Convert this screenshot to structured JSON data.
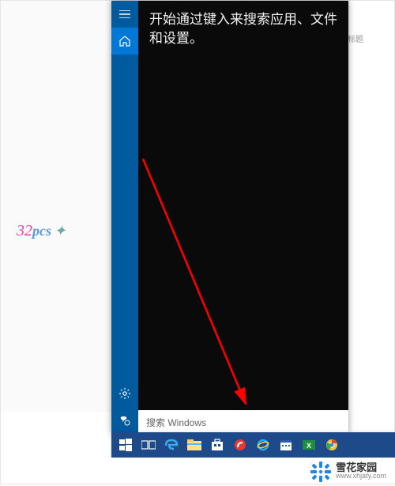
{
  "desktop": {
    "logo_text_1": "32",
    "logo_text_2": "pcs"
  },
  "right_app": {
    "title": "标题"
  },
  "start": {
    "hint": "开始通过键入来搜索应用、文件和设置。",
    "search_placeholder": "搜索 Windows",
    "sidebar": {
      "hamburger": "hamburger",
      "home": "home",
      "settings": "settings",
      "power": "power"
    }
  },
  "taskbar": {
    "items": [
      {
        "name": "start",
        "color": "#ffffff"
      },
      {
        "name": "task-view",
        "color": "#ffffff"
      },
      {
        "name": "edge",
        "color": "#0e7fd1"
      },
      {
        "name": "file-explorer",
        "color": "#ffd86b"
      },
      {
        "name": "store",
        "color": "#ffffff"
      },
      {
        "name": "app-red",
        "color": "#e53935"
      },
      {
        "name": "ie",
        "color": "#2aa9e0"
      },
      {
        "name": "calendar",
        "color": "#ffffff"
      },
      {
        "name": "excel",
        "color": "#1d8f3e"
      },
      {
        "name": "chrome",
        "color": "#f2c43c"
      }
    ]
  },
  "watermark": {
    "title": "雪花家园",
    "url": "www.xhjaty.com"
  }
}
